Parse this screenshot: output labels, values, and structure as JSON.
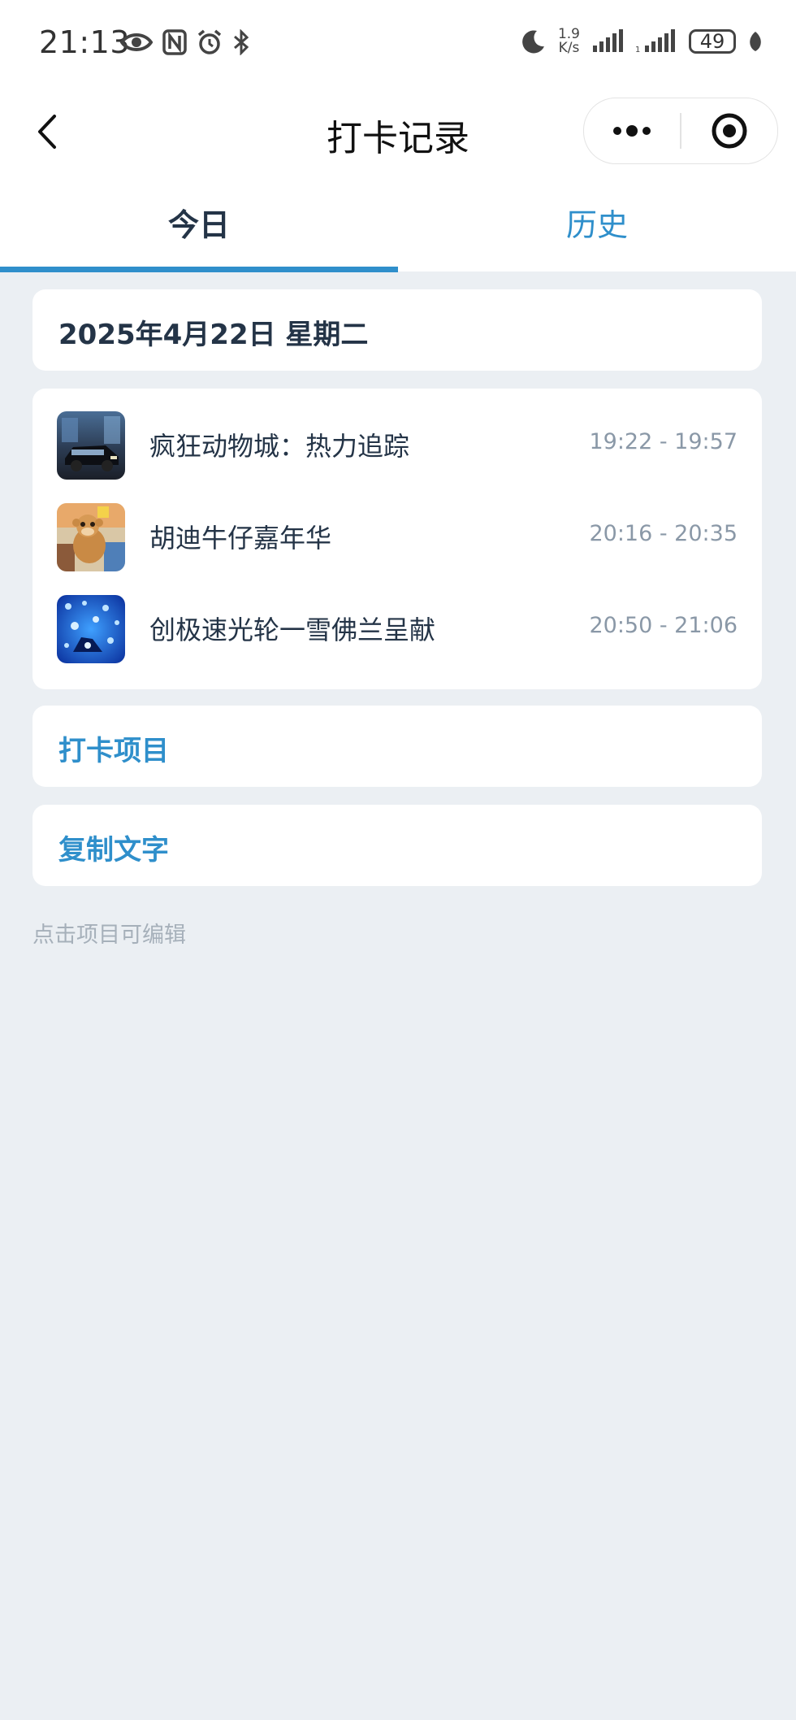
{
  "status_bar": {
    "time": "21:13",
    "speed_top": "1.9",
    "speed_bottom": "K/s",
    "battery": "49",
    "icons_left": [
      "eye-icon",
      "nfc-icon",
      "alarm-icon",
      "bluetooth-icon"
    ],
    "icons_right": [
      "moon-icon",
      "signal-icon",
      "signal-icon-2",
      "leaf-icon"
    ]
  },
  "nav": {
    "title": "打卡记录",
    "back_icon": "chevron-left-icon",
    "more_icon": "more-dots-icon",
    "target_icon": "target-icon"
  },
  "tabs": [
    {
      "label": "今日",
      "active": true
    },
    {
      "label": "历史",
      "active": false
    }
  ],
  "accent_color": "#2f8fcb",
  "date_header": "2025年4月22日 星期二",
  "records": [
    {
      "title": "疯狂动物城：热力追踪",
      "time": "19:22 - 19:57"
    },
    {
      "title": "胡迪牛仔嘉年华",
      "time": "20:16 - 20:35"
    },
    {
      "title": "创极速光轮一雪佛兰呈献",
      "time": "20:50 - 21:06"
    }
  ],
  "actions": {
    "checkin_items": "打卡项目",
    "copy_text": "复制文字"
  },
  "hint": "点击项目可编辑"
}
